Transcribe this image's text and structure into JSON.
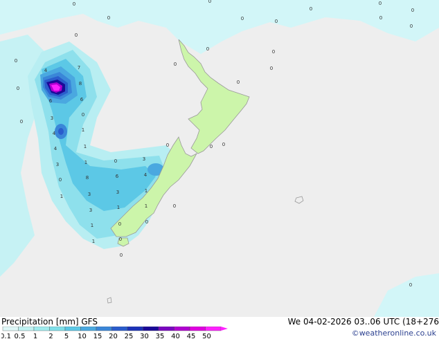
{
  "title": "Precipitation [mm] GFS",
  "valid_time": "We 04-02-2026 03..06 UTC (18+276",
  "credit": "©weatheronline.co.uk",
  "legend": {
    "labels": [
      "0.1",
      "0.5",
      "1",
      "2",
      "5",
      "10",
      "15",
      "20",
      "25",
      "30",
      "35",
      "40",
      "45",
      "50"
    ],
    "colors": [
      "#e0f8f8",
      "#c0f2f2",
      "#a0ecee",
      "#80e0ea",
      "#5cc8e6",
      "#4aa8e0",
      "#3a86d8",
      "#2a5ccc",
      "#1c32b8",
      "#1a0a98",
      "#7a08c0",
      "#b000d0",
      "#e000e0",
      "#ff22ff"
    ]
  },
  "colors": {
    "sea": "#eeeeee",
    "land": "#ccf5aa",
    "coast": "#999999"
  },
  "value_labels": [
    "0",
    "0",
    "0",
    "0",
    "0",
    "0",
    "0",
    "0",
    "0",
    "0",
    "0",
    "0",
    "0",
    "0",
    "0",
    "0",
    "0",
    "0",
    "0",
    "0",
    "0",
    "0",
    "4",
    "7",
    "8",
    "6",
    "6",
    "0",
    "3",
    "1",
    "4",
    "1",
    "4",
    "1",
    "3",
    "0",
    "3",
    "0",
    "8",
    "6",
    "4",
    "1",
    "3",
    "3",
    "1",
    "3",
    "1",
    "1",
    "1",
    "1",
    "0",
    "0",
    "0",
    "0",
    "0",
    "0"
  ]
}
